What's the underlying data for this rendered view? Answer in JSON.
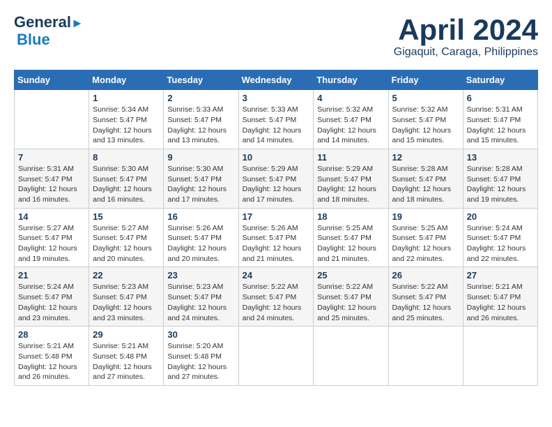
{
  "header": {
    "logo_line1": "General",
    "logo_line2": "Blue",
    "month": "April 2024",
    "location": "Gigaquit, Caraga, Philippines"
  },
  "days_of_week": [
    "Sunday",
    "Monday",
    "Tuesday",
    "Wednesday",
    "Thursday",
    "Friday",
    "Saturday"
  ],
  "weeks": [
    [
      {
        "day": "",
        "info": ""
      },
      {
        "day": "1",
        "info": "Sunrise: 5:34 AM\nSunset: 5:47 PM\nDaylight: 12 hours\nand 13 minutes."
      },
      {
        "day": "2",
        "info": "Sunrise: 5:33 AM\nSunset: 5:47 PM\nDaylight: 12 hours\nand 13 minutes."
      },
      {
        "day": "3",
        "info": "Sunrise: 5:33 AM\nSunset: 5:47 PM\nDaylight: 12 hours\nand 14 minutes."
      },
      {
        "day": "4",
        "info": "Sunrise: 5:32 AM\nSunset: 5:47 PM\nDaylight: 12 hours\nand 14 minutes."
      },
      {
        "day": "5",
        "info": "Sunrise: 5:32 AM\nSunset: 5:47 PM\nDaylight: 12 hours\nand 15 minutes."
      },
      {
        "day": "6",
        "info": "Sunrise: 5:31 AM\nSunset: 5:47 PM\nDaylight: 12 hours\nand 15 minutes."
      }
    ],
    [
      {
        "day": "7",
        "info": "Sunrise: 5:31 AM\nSunset: 5:47 PM\nDaylight: 12 hours\nand 16 minutes."
      },
      {
        "day": "8",
        "info": "Sunrise: 5:30 AM\nSunset: 5:47 PM\nDaylight: 12 hours\nand 16 minutes."
      },
      {
        "day": "9",
        "info": "Sunrise: 5:30 AM\nSunset: 5:47 PM\nDaylight: 12 hours\nand 17 minutes."
      },
      {
        "day": "10",
        "info": "Sunrise: 5:29 AM\nSunset: 5:47 PM\nDaylight: 12 hours\nand 17 minutes."
      },
      {
        "day": "11",
        "info": "Sunrise: 5:29 AM\nSunset: 5:47 PM\nDaylight: 12 hours\nand 18 minutes."
      },
      {
        "day": "12",
        "info": "Sunrise: 5:28 AM\nSunset: 5:47 PM\nDaylight: 12 hours\nand 18 minutes."
      },
      {
        "day": "13",
        "info": "Sunrise: 5:28 AM\nSunset: 5:47 PM\nDaylight: 12 hours\nand 19 minutes."
      }
    ],
    [
      {
        "day": "14",
        "info": "Sunrise: 5:27 AM\nSunset: 5:47 PM\nDaylight: 12 hours\nand 19 minutes."
      },
      {
        "day": "15",
        "info": "Sunrise: 5:27 AM\nSunset: 5:47 PM\nDaylight: 12 hours\nand 20 minutes."
      },
      {
        "day": "16",
        "info": "Sunrise: 5:26 AM\nSunset: 5:47 PM\nDaylight: 12 hours\nand 20 minutes."
      },
      {
        "day": "17",
        "info": "Sunrise: 5:26 AM\nSunset: 5:47 PM\nDaylight: 12 hours\nand 21 minutes."
      },
      {
        "day": "18",
        "info": "Sunrise: 5:25 AM\nSunset: 5:47 PM\nDaylight: 12 hours\nand 21 minutes."
      },
      {
        "day": "19",
        "info": "Sunrise: 5:25 AM\nSunset: 5:47 PM\nDaylight: 12 hours\nand 22 minutes."
      },
      {
        "day": "20",
        "info": "Sunrise: 5:24 AM\nSunset: 5:47 PM\nDaylight: 12 hours\nand 22 minutes."
      }
    ],
    [
      {
        "day": "21",
        "info": "Sunrise: 5:24 AM\nSunset: 5:47 PM\nDaylight: 12 hours\nand 23 minutes."
      },
      {
        "day": "22",
        "info": "Sunrise: 5:23 AM\nSunset: 5:47 PM\nDaylight: 12 hours\nand 23 minutes."
      },
      {
        "day": "23",
        "info": "Sunrise: 5:23 AM\nSunset: 5:47 PM\nDaylight: 12 hours\nand 24 minutes."
      },
      {
        "day": "24",
        "info": "Sunrise: 5:22 AM\nSunset: 5:47 PM\nDaylight: 12 hours\nand 24 minutes."
      },
      {
        "day": "25",
        "info": "Sunrise: 5:22 AM\nSunset: 5:47 PM\nDaylight: 12 hours\nand 25 minutes."
      },
      {
        "day": "26",
        "info": "Sunrise: 5:22 AM\nSunset: 5:47 PM\nDaylight: 12 hours\nand 25 minutes."
      },
      {
        "day": "27",
        "info": "Sunrise: 5:21 AM\nSunset: 5:47 PM\nDaylight: 12 hours\nand 26 minutes."
      }
    ],
    [
      {
        "day": "28",
        "info": "Sunrise: 5:21 AM\nSunset: 5:48 PM\nDaylight: 12 hours\nand 26 minutes."
      },
      {
        "day": "29",
        "info": "Sunrise: 5:21 AM\nSunset: 5:48 PM\nDaylight: 12 hours\nand 27 minutes."
      },
      {
        "day": "30",
        "info": "Sunrise: 5:20 AM\nSunset: 5:48 PM\nDaylight: 12 hours\nand 27 minutes."
      },
      {
        "day": "",
        "info": ""
      },
      {
        "day": "",
        "info": ""
      },
      {
        "day": "",
        "info": ""
      },
      {
        "day": "",
        "info": ""
      }
    ]
  ]
}
